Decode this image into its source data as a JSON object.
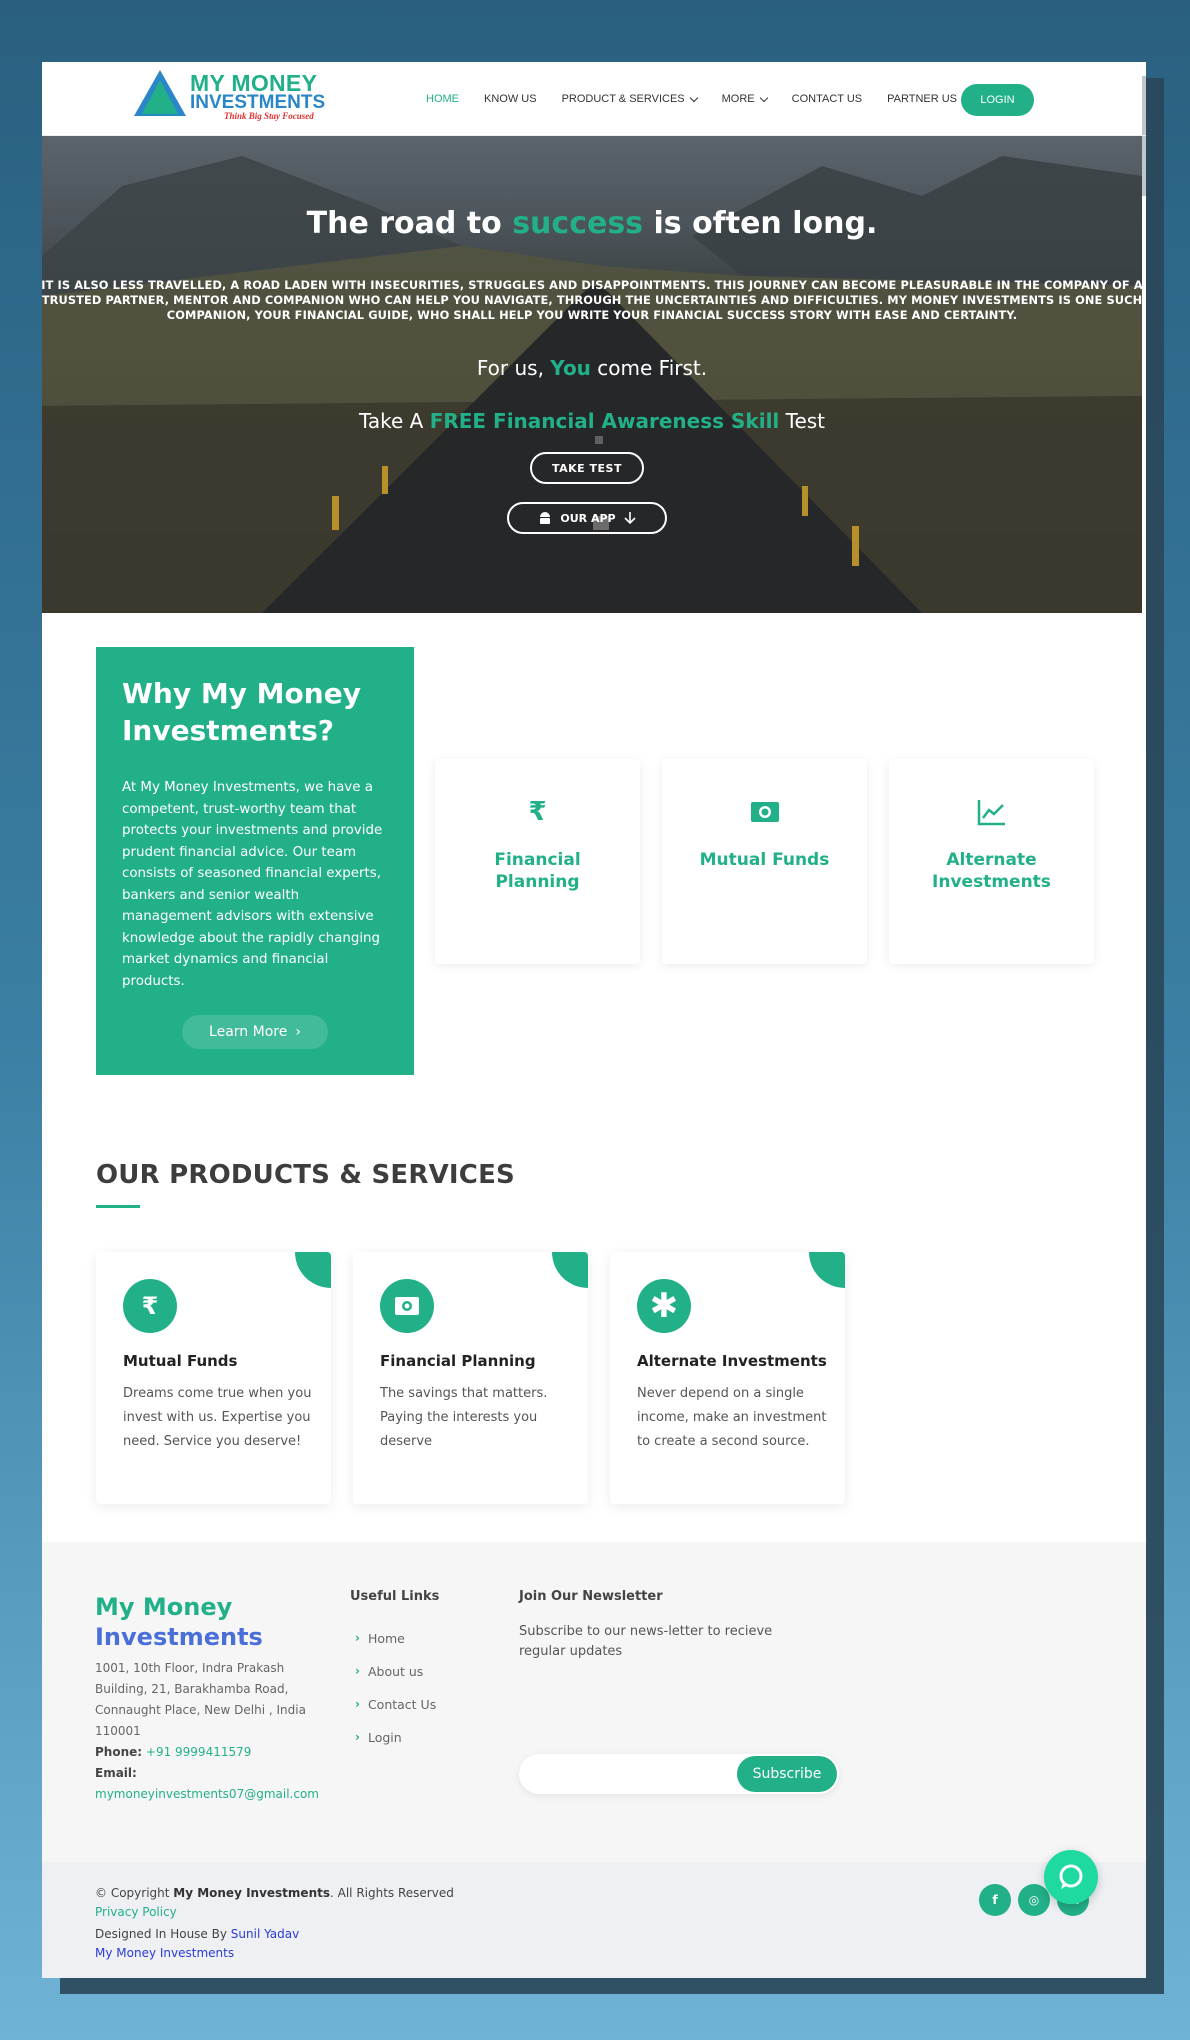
{
  "brand": {
    "line1": "MY MONEY",
    "line2": "INVESTMENTS",
    "tagline": "Think Big Stay Focused",
    "accent": "#22b089",
    "blue": "#2b86c8"
  },
  "nav": {
    "items": [
      {
        "label": "HOME",
        "active": true
      },
      {
        "label": "KNOW US"
      },
      {
        "label": "PRODUCT & SERVICES",
        "dropdown": true
      },
      {
        "label": "MORE",
        "dropdown": true
      },
      {
        "label": "CONTACT US"
      },
      {
        "label": "PARTNER US"
      }
    ],
    "login": "LOGIN"
  },
  "hero": {
    "title_pre": "The road to ",
    "title_hl": "success",
    "title_post": " is often long.",
    "body": "IT IS ALSO LESS TRAVELLED, A ROAD LADEN WITH INSECURITIES, STRUGGLES AND DISAPPOINTMENTS. THIS JOURNEY CAN BECOME PLEASURABLE IN THE COMPANY OF A TRUSTED PARTNER, MENTOR AND COMPANION WHO CAN HELP YOU NAVIGATE, THROUGH THE UNCERTAINTIES AND DIFFICULTIES. MY MONEY INVESTMENTS IS ONE SUCH COMPANION, YOUR FINANCIAL GUIDE, WHO SHALL HELP YOU WRITE YOUR FINANCIAL SUCCESS STORY WITH EASE AND CERTAINTY.",
    "first_pre": "For us, ",
    "first_hl": "You",
    "first_post": " come First.",
    "test_pre": "Take A ",
    "test_hl": "FREE Financial Awareness Skill",
    "test_post": " Test",
    "take_test": "TAKE TEST",
    "our_app": "OUR APP"
  },
  "why": {
    "title": "Why My Money Investments?",
    "text": "At My Money Investments, we have a competent, trust-worthy team that protects your investments and provide prudent financial advice. Our team consists of seasoned financial experts, bankers and senior wealth management advisors with extensive knowledge about the rapidly changing market dynamics and financial products.",
    "button": "Learn More"
  },
  "features": [
    {
      "icon": "rupee-icon",
      "label": "Financial Planning"
    },
    {
      "icon": "money-bill-icon",
      "label": "Mutual Funds"
    },
    {
      "icon": "line-chart-icon",
      "label": "Alternate Investments"
    }
  ],
  "products": {
    "title": "OUR PRODUCTS & SERVICES",
    "items": [
      {
        "icon": "rupee-icon",
        "title": "Mutual Funds",
        "desc": "Dreams come true when you invest with us. Expertise you need. Service you deserve!"
      },
      {
        "icon": "money-bill-icon",
        "title": "Financial Planning",
        "desc": "The savings that matters. Paying the interests you deserve"
      },
      {
        "icon": "asterisk-icon",
        "title": "Alternate Investments",
        "desc": "Never depend on a single income, make an investment to create a second source."
      }
    ]
  },
  "footer": {
    "brand_line1": "My Money",
    "brand_line2": "Investments",
    "address": "1001, 10th Floor, Indra Prakash Building, 21, Barakhamba Road, Connaught Place, New Delhi , India 110001",
    "phone_label": "Phone:",
    "phone": "+91 9999411579",
    "email_label": "Email:",
    "email": "mymoneyinvestments07@gmail.com",
    "links_title": "Useful Links",
    "links": [
      "Home",
      "About us",
      "Contact Us",
      "Login"
    ],
    "newsletter_title": "Join Our Newsletter",
    "newsletter_text": "Subscribe to our news-letter to recieve regular updates",
    "newsletter_placeholder": "",
    "subscribe": "Subscribe"
  },
  "bottom": {
    "copy_pre": "© Copyright ",
    "copy_brand": "My Money Investments",
    "copy_post": ". All Rights Reserved",
    "privacy": "Privacy Policy",
    "designed_pre": "Designed In House By ",
    "designer": "Sunil Yadav",
    "site": "My Money Investments",
    "social": [
      {
        "icon": "facebook-icon",
        "glyph": "f"
      },
      {
        "icon": "instagram-icon",
        "glyph": "◎"
      },
      {
        "icon": "linkedin-icon",
        "glyph": "in"
      }
    ]
  }
}
